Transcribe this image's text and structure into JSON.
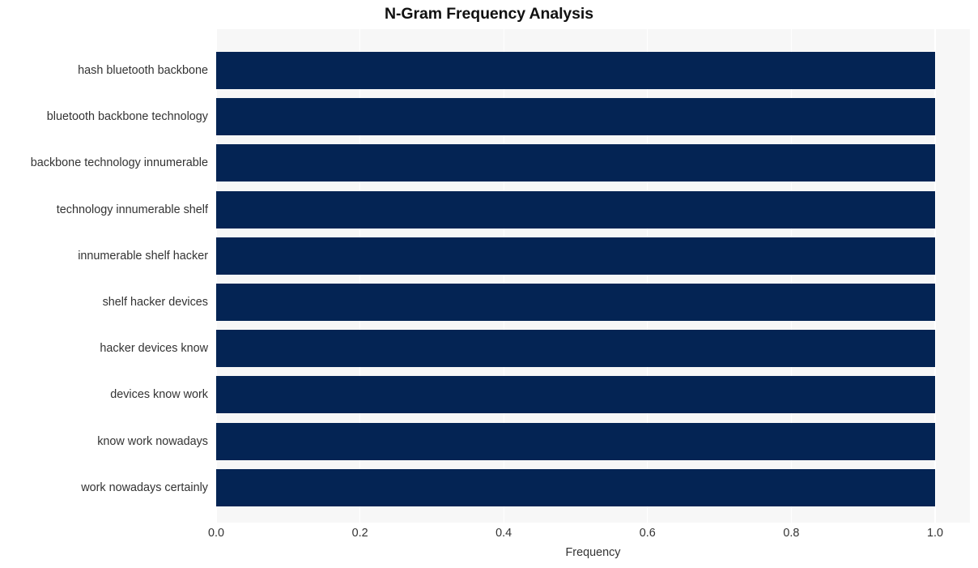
{
  "chart_data": {
    "type": "bar",
    "orientation": "horizontal",
    "title": "N-Gram Frequency Analysis",
    "xlabel": "Frequency",
    "ylabel": "",
    "categories": [
      "hash bluetooth backbone",
      "bluetooth backbone technology",
      "backbone technology innumerable",
      "technology innumerable shelf",
      "innumerable shelf hacker",
      "shelf hacker devices",
      "hacker devices know",
      "devices know work",
      "know work nowadays",
      "work nowadays certainly"
    ],
    "values": [
      1.0,
      1.0,
      1.0,
      1.0,
      1.0,
      1.0,
      1.0,
      1.0,
      1.0,
      1.0
    ],
    "xlim": [
      0.0,
      1.0
    ],
    "x_ticks": [
      0.0,
      0.2,
      0.4,
      0.6,
      0.8,
      1.0
    ],
    "x_tick_labels": [
      "0.0",
      "0.2",
      "0.4",
      "0.6",
      "0.8",
      "1.0"
    ],
    "grid": true,
    "grid_axis": "x",
    "legend": null,
    "bar_color": "#042454",
    "plot_background": "#f7f7f7",
    "figure_background": "#ffffff",
    "gridline_color": "#ffffff",
    "text_color": "#333333",
    "title_color": "#111111"
  }
}
